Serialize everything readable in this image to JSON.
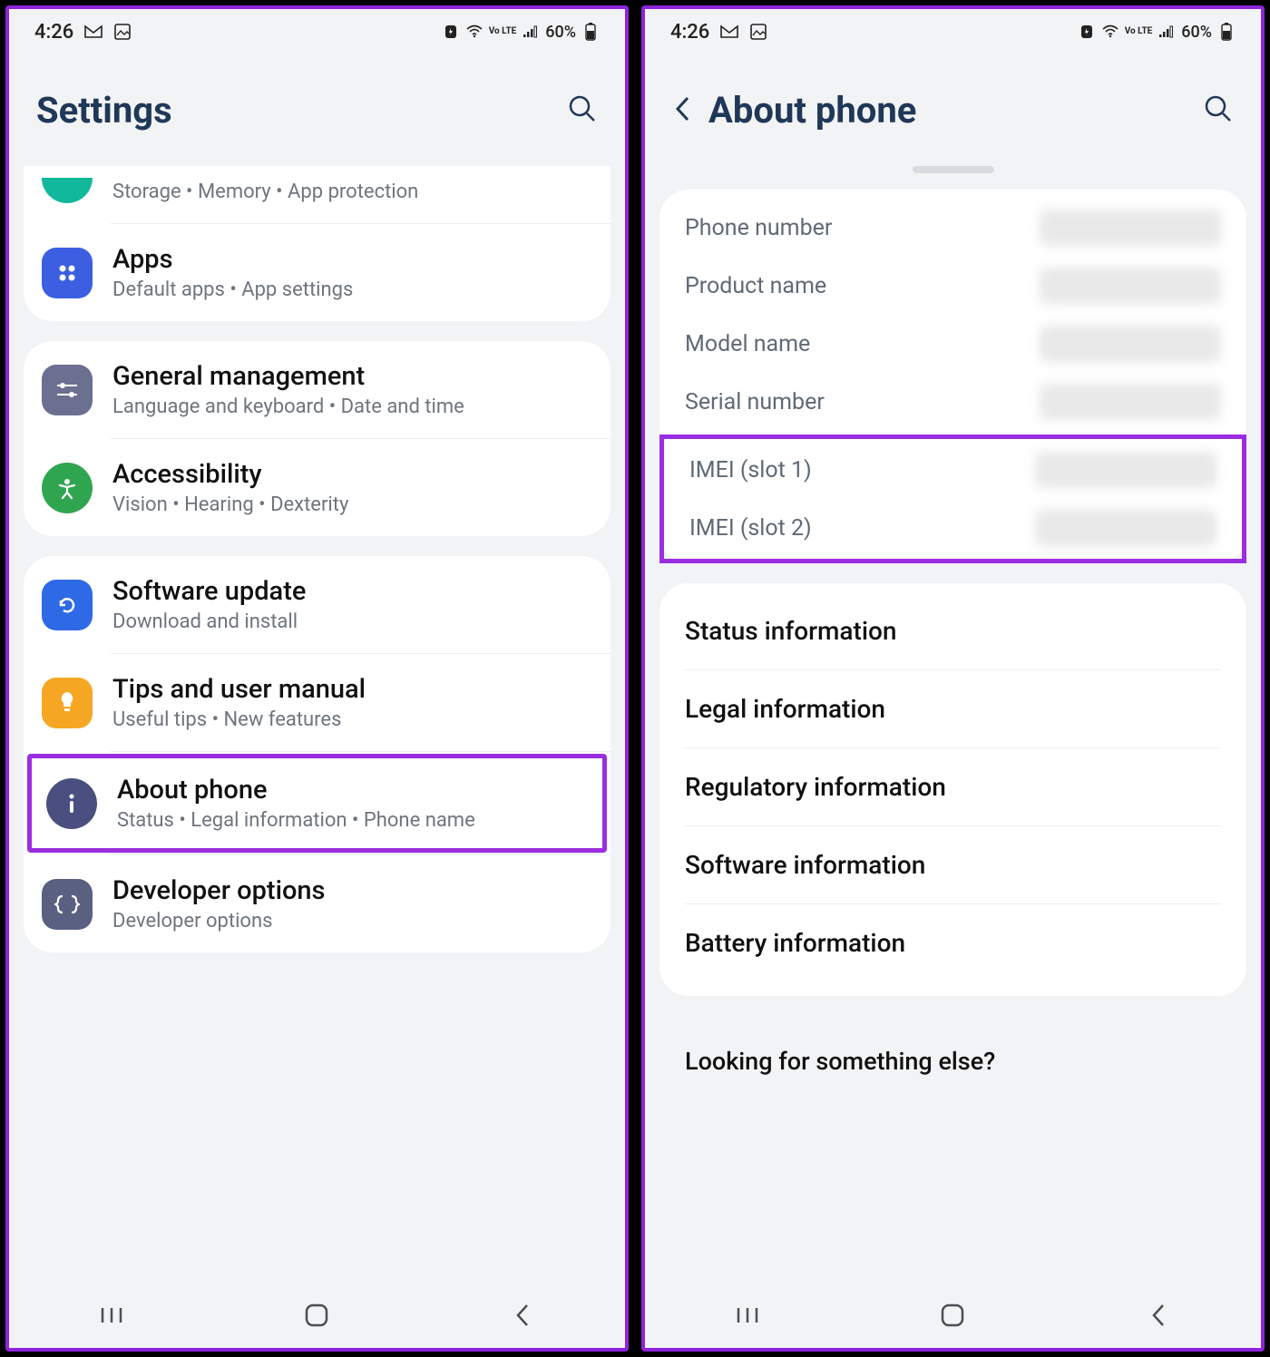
{
  "status": {
    "time": "4:26",
    "battery": "60%",
    "volte": "Vo LTE"
  },
  "left": {
    "title": "Settings",
    "rowStorage": {
      "sub": "Storage  •  Memory  •  App protection"
    },
    "rowApps": {
      "title": "Apps",
      "sub": "Default apps  •  App settings"
    },
    "rowGeneral": {
      "title": "General management",
      "sub": "Language and keyboard  •  Date and time"
    },
    "rowAccessibility": {
      "title": "Accessibility",
      "sub": "Vision  •  Hearing  •  Dexterity"
    },
    "rowSoftware": {
      "title": "Software update",
      "sub": "Download and install"
    },
    "rowTips": {
      "title": "Tips and user manual",
      "sub": "Useful tips  •  New features"
    },
    "rowAbout": {
      "title": "About phone",
      "sub": "Status  •  Legal information  •  Phone name"
    },
    "rowDev": {
      "title": "Developer options",
      "sub": "Developer options"
    }
  },
  "right": {
    "title": "About phone",
    "labels": {
      "phoneNumber": "Phone number",
      "productName": "Product name",
      "modelName": "Model name",
      "serialNumber": "Serial number",
      "imei1": "IMEI (slot 1)",
      "imei2": "IMEI (slot 2)"
    },
    "items": {
      "status": "Status information",
      "legal": "Legal information",
      "regulatory": "Regulatory information",
      "software": "Software information",
      "battery": "Battery information"
    },
    "footer": "Looking for something else?"
  }
}
